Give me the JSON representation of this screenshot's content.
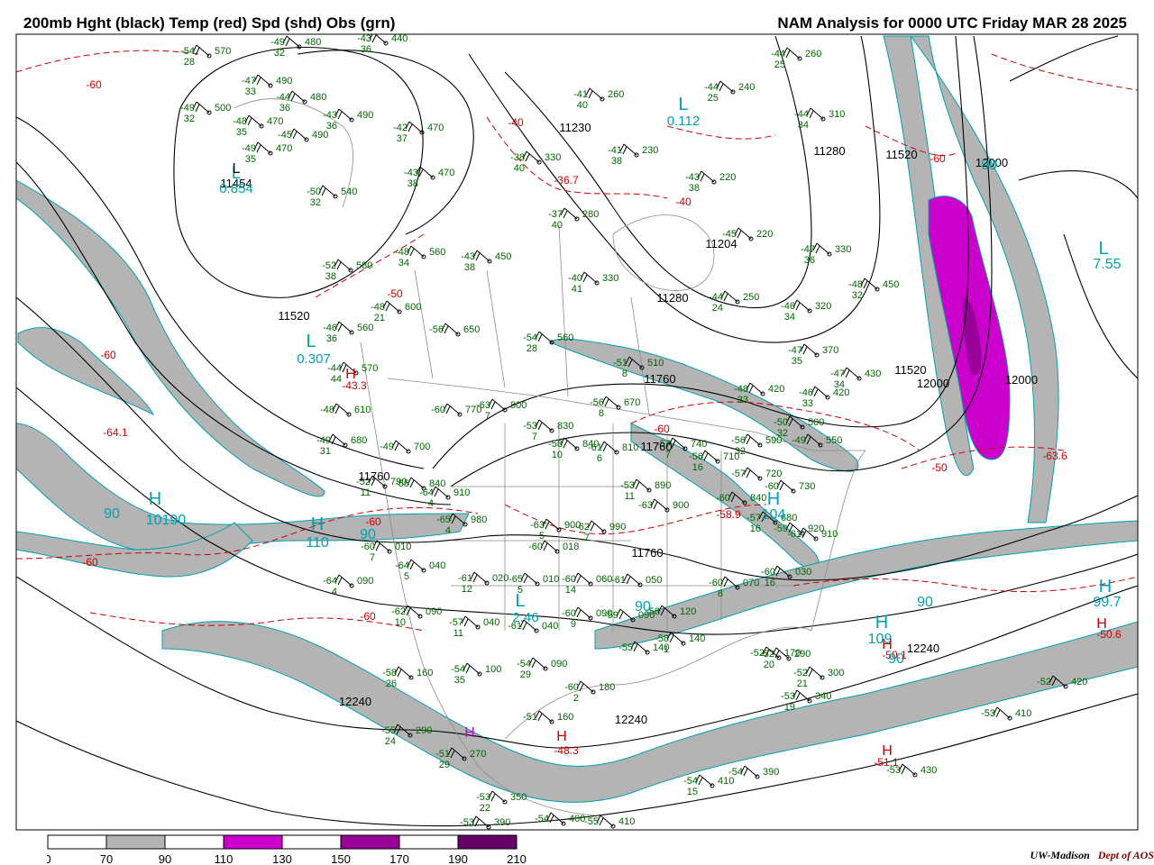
{
  "header": {
    "title_left": "200mb Hght (black) Temp (red) Spd (shd) Obs (grn)",
    "title_right": "NAM Analysis for 0000 UTC Friday  MAR 28 2025"
  },
  "legend": {
    "scale": [
      {
        "from": "0",
        "color": "#ffffff"
      },
      {
        "from": "70",
        "color": "#b4b4b4"
      },
      {
        "from": "90",
        "color": "#ffffff"
      },
      {
        "from": "110",
        "color": "#cc00cc"
      },
      {
        "from": "130",
        "color": "#ffffff"
      },
      {
        "from": "150",
        "color": "#990099"
      },
      {
        "from": "170",
        "color": "#ffffff"
      },
      {
        "from": "190",
        "color": "#660066"
      },
      {
        "from": "210",
        "color": "#ffffff"
      }
    ],
    "labels": [
      "0",
      "70",
      "90",
      "110",
      "130",
      "150",
      "170",
      "190",
      "210"
    ]
  },
  "credit": {
    "org": "UW-Madison",
    "dept": "Dept of AOS"
  },
  "colors": {
    "height": "#000000",
    "temp": "#cc0000",
    "speed_shade": "#b4b4b4",
    "jet_core": "#cc00cc",
    "obs": "#006600",
    "cyan": "#00a0b0"
  },
  "height_labels": [
    "11520",
    "11760",
    "12000",
    "11454",
    "11230",
    "11280",
    "11204",
    "11280",
    "11520",
    "11520",
    "11760",
    "11760",
    "12000",
    "12240",
    "12240",
    "11760",
    "12000",
    "12240"
  ],
  "temp_labels": [
    "-60",
    "-40",
    "-50",
    "-60",
    "-60",
    "-60",
    "-50",
    "-40",
    "-36.7",
    "-43.3",
    "-64.1",
    "-63.6",
    "-58.9",
    "-50.6",
    "-50.1",
    "-51.1",
    "-48.3",
    "-60",
    "-60",
    "-60"
  ],
  "cyan_labels": [
    "L",
    "0.112",
    "L",
    "0.854",
    "L",
    "0.307",
    "L",
    "7.55",
    "H",
    "10190",
    "90",
    "H",
    "110",
    "90",
    "L",
    "2.46",
    "H",
    "104",
    "H",
    "109",
    "90",
    "H",
    "99.7",
    "90",
    "90",
    "90"
  ],
  "hl_markers": [
    "H",
    "H",
    "H",
    "H",
    "H",
    "H",
    "L"
  ],
  "stations": [
    {
      "t": "-54",
      "h": "570",
      "d": "28"
    },
    {
      "t": "-49",
      "h": "480",
      "d": "32"
    },
    {
      "t": "-43",
      "h": "440",
      "d": "36"
    },
    {
      "t": "-47",
      "h": "490",
      "d": "33"
    },
    {
      "t": "-44",
      "h": "480",
      "d": "36"
    },
    {
      "t": "-49",
      "h": "500",
      "d": "32"
    },
    {
      "t": "-48",
      "h": "470",
      "d": "35"
    },
    {
      "t": "-43",
      "h": "490",
      "d": "36"
    },
    {
      "t": "-45",
      "h": "490",
      "d": ""
    },
    {
      "t": "-49",
      "h": "470",
      "d": "35"
    },
    {
      "t": "-42",
      "h": "470",
      "d": "37"
    },
    {
      "t": "-41",
      "h": "260",
      "d": "40"
    },
    {
      "t": "-44",
      "h": "260",
      "d": "25"
    },
    {
      "t": "-44",
      "h": "240",
      "d": "25"
    },
    {
      "t": "-44",
      "h": "310",
      "d": "34"
    },
    {
      "t": "-38",
      "h": "330",
      "d": "40"
    },
    {
      "t": "-41",
      "h": "230",
      "d": "38"
    },
    {
      "t": "-43",
      "h": "470",
      "d": "38"
    },
    {
      "t": "-43",
      "h": "220",
      "d": "38"
    },
    {
      "t": "-50",
      "h": "540",
      "d": "32"
    },
    {
      "t": "-37",
      "h": "280",
      "d": "40"
    },
    {
      "t": "-45",
      "h": "220",
      "d": ""
    },
    {
      "t": "-48",
      "h": "560",
      "d": "34"
    },
    {
      "t": "-43",
      "h": "450",
      "d": "38"
    },
    {
      "t": "-47",
      "h": "330",
      "d": "36"
    },
    {
      "t": "-52",
      "h": "580",
      "d": "38"
    },
    {
      "t": "-40",
      "h": "330",
      "d": "41"
    },
    {
      "t": "-44",
      "h": "250",
      "d": "24"
    },
    {
      "t": "-48",
      "h": "450",
      "d": "32"
    },
    {
      "t": "-48",
      "h": "600",
      "d": "21"
    },
    {
      "t": "-46",
      "h": "320",
      "d": "34"
    },
    {
      "t": "-46",
      "h": "560",
      "d": "36"
    },
    {
      "t": "-56",
      "h": "650",
      "d": ""
    },
    {
      "t": "-54",
      "h": "560",
      "d": "28"
    },
    {
      "t": "-47",
      "h": "370",
      "d": "35"
    },
    {
      "t": "-44",
      "h": "570",
      "d": "44"
    },
    {
      "t": "-51",
      "h": "510",
      "d": "8"
    },
    {
      "t": "-47",
      "h": "430",
      "d": "34"
    },
    {
      "t": "-48",
      "h": "420",
      "d": "33"
    },
    {
      "t": "-46",
      "h": "420",
      "d": "33"
    },
    {
      "t": "-48",
      "h": "610",
      "d": ""
    },
    {
      "t": "-60",
      "h": "770",
      "d": ""
    },
    {
      "t": "-63",
      "h": "800",
      "d": "7"
    },
    {
      "t": "-56",
      "h": "670",
      "d": "8"
    },
    {
      "t": "-50",
      "h": "500",
      "d": "32"
    },
    {
      "t": "-49",
      "h": "680",
      "d": "31"
    },
    {
      "t": "-53",
      "h": "830",
      "d": "7"
    },
    {
      "t": "-58",
      "h": "840",
      "d": "10"
    },
    {
      "t": "-61",
      "h": "810",
      "d": "6"
    },
    {
      "t": "-57",
      "h": "740",
      "d": "7"
    },
    {
      "t": "-56",
      "h": "590",
      "d": "32"
    },
    {
      "t": "-49",
      "h": "550",
      "d": ""
    },
    {
      "t": "-49",
      "h": "700",
      "d": ""
    },
    {
      "t": "-56",
      "h": "710",
      "d": "16"
    },
    {
      "t": "-63",
      "h": "900",
      "d": ""
    },
    {
      "t": "-57",
      "h": "720",
      "d": ""
    },
    {
      "t": "-52",
      "h": "790",
      "d": "11"
    },
    {
      "t": "-55",
      "h": "840",
      "d": ""
    },
    {
      "t": "-64",
      "h": "910",
      "d": "4"
    },
    {
      "t": "-53",
      "h": "890",
      "d": "11"
    },
    {
      "t": "-60",
      "h": "840",
      "d": ""
    },
    {
      "t": "-60",
      "h": "730",
      "d": ""
    },
    {
      "t": "-65",
      "h": "980",
      "d": "4"
    },
    {
      "t": "-63",
      "h": "900",
      "d": "5"
    },
    {
      "t": "-62",
      "h": "990",
      "d": "7"
    },
    {
      "t": "-57",
      "h": "680",
      "d": "16"
    },
    {
      "t": "-59",
      "h": "920",
      "d": ""
    },
    {
      "t": "-61",
      "h": "910",
      "d": ""
    },
    {
      "t": "-60",
      "h": "010",
      "d": "7"
    },
    {
      "t": "-60",
      "h": "018",
      "d": ""
    },
    {
      "t": "-64",
      "h": "040",
      "d": "5"
    },
    {
      "t": "-61",
      "h": "020",
      "d": "12"
    },
    {
      "t": "-65",
      "h": "010",
      "d": "5"
    },
    {
      "t": "-60",
      "h": "060",
      "d": "14"
    },
    {
      "t": "-61",
      "h": "050",
      "d": ""
    },
    {
      "t": "-60",
      "h": "070",
      "d": "8"
    },
    {
      "t": "-60",
      "h": "030",
      "d": "16"
    },
    {
      "t": "-64",
      "h": "090",
      "d": "4"
    },
    {
      "t": "-62",
      "h": "090",
      "d": "10"
    },
    {
      "t": "-57",
      "h": "040",
      "d": "11"
    },
    {
      "t": "-61",
      "h": "040",
      "d": ""
    },
    {
      "t": "-60",
      "h": "090",
      "d": "9"
    },
    {
      "t": "-59",
      "h": "090",
      "d": ""
    },
    {
      "t": "-58",
      "h": "120",
      "d": ""
    },
    {
      "t": "-55",
      "h": "140",
      "d": ""
    },
    {
      "t": "-58",
      "h": "140",
      "d": "1"
    },
    {
      "t": "-52",
      "h": "170",
      "d": ""
    },
    {
      "t": "-58",
      "h": "160",
      "d": "26"
    },
    {
      "t": "-54",
      "h": "100",
      "d": "35"
    },
    {
      "t": "-54",
      "h": "090",
      "d": "29"
    },
    {
      "t": "-52",
      "h": "290",
      "d": "20"
    },
    {
      "t": "-52",
      "h": "300",
      "d": "21"
    },
    {
      "t": "-60",
      "h": "180",
      "d": "2"
    },
    {
      "t": "-53",
      "h": "340",
      "d": "19"
    },
    {
      "t": "-52",
      "h": "420",
      "d": ""
    },
    {
      "t": "-51",
      "h": "160",
      "d": ""
    },
    {
      "t": "-55",
      "h": "290",
      "d": "24"
    },
    {
      "t": "-53",
      "h": "410",
      "d": ""
    },
    {
      "t": "-51",
      "h": "270",
      "d": "29"
    },
    {
      "t": "-53",
      "h": "350",
      "d": "22"
    },
    {
      "t": "-54",
      "h": "390",
      "d": ""
    },
    {
      "t": "-54",
      "h": "410",
      "d": "15"
    },
    {
      "t": "-53",
      "h": "430",
      "d": ""
    },
    {
      "t": "-53",
      "h": "390",
      "d": ""
    },
    {
      "t": "-54",
      "h": "400",
      "d": ""
    },
    {
      "t": "-55",
      "h": "410",
      "d": ""
    }
  ]
}
